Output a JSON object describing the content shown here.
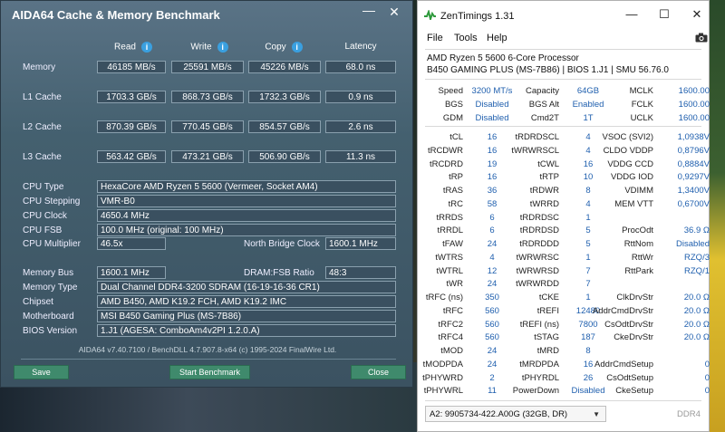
{
  "aida": {
    "title": "AIDA64 Cache & Memory Benchmark",
    "minimize_glyph": "—",
    "close_glyph": "✕",
    "columns": {
      "read": "Read",
      "write": "Write",
      "copy": "Copy",
      "latency": "Latency"
    },
    "rows": [
      {
        "label": "Memory",
        "read": "46185 MB/s",
        "write": "25591 MB/s",
        "copy": "45226 MB/s",
        "latency": "68.0 ns"
      },
      {
        "label": "L1 Cache",
        "read": "1703.3 GB/s",
        "write": "868.73 GB/s",
        "copy": "1732.3 GB/s",
        "latency": "0.9 ns"
      },
      {
        "label": "L2 Cache",
        "read": "870.39 GB/s",
        "write": "770.45 GB/s",
        "copy": "854.57 GB/s",
        "latency": "2.6 ns"
      },
      {
        "label": "L3 Cache",
        "read": "563.42 GB/s",
        "write": "473.21 GB/s",
        "copy": "506.90 GB/s",
        "latency": "11.3 ns"
      }
    ],
    "cpu": {
      "type_label": "CPU Type",
      "type": "HexaCore AMD Ryzen 5 5600  (Vermeer, Socket AM4)",
      "stepping_label": "CPU Stepping",
      "stepping": "VMR-B0",
      "clock_label": "CPU Clock",
      "clock": "4650.4 MHz",
      "fsb_label": "CPU FSB",
      "fsb": "100.0 MHz  (original: 100 MHz)",
      "mult_label": "CPU Multiplier",
      "mult": "46.5x",
      "nb_label": "North Bridge Clock",
      "nb": "1600.1 MHz"
    },
    "mem": {
      "bus_label": "Memory Bus",
      "bus": "1600.1 MHz",
      "ratio_label": "DRAM:FSB Ratio",
      "ratio": "48:3",
      "type_label": "Memory Type",
      "type": "Dual Channel DDR4-3200 SDRAM  (16-19-16-36 CR1)",
      "chipset_label": "Chipset",
      "chipset": "AMD B450, AMD K19.2 FCH, AMD K19.2 IMC",
      "mb_label": "Motherboard",
      "mb": "MSI B450 Gaming Plus (MS-7B86)",
      "bios_label": "BIOS Version",
      "bios": "1.J1  (AGESA: ComboAm4v2PI 1.2.0.A)"
    },
    "footer": "AIDA64 v7.40.7100 / BenchDLL 4.7.907.8-x64  (c) 1995-2024 FinalWire Ltd.",
    "buttons": {
      "save": "Save",
      "start": "Start Benchmark",
      "close": "Close"
    }
  },
  "zen": {
    "title": "ZenTimings 1.31",
    "win": {
      "min": "—",
      "max": "☐",
      "close": "✕"
    },
    "menu": {
      "file": "File",
      "tools": "Tools",
      "help": "Help"
    },
    "cpu_name": "AMD Ryzen 5 5600 6-Core Processor",
    "board": "B450 GAMING PLUS (MS-7B86) | BIOS 1.J1 | SMU 56.76.0",
    "top": [
      [
        {
          "l": "Speed",
          "v": "3200 MT/s"
        },
        {
          "l": "Capacity",
          "v": "64GB"
        },
        {
          "l": "MCLK",
          "v": "1600.00"
        }
      ],
      [
        {
          "l": "BGS",
          "v": "Disabled"
        },
        {
          "l": "BGS Alt",
          "v": "Enabled"
        },
        {
          "l": "FCLK",
          "v": "1600.00"
        }
      ],
      [
        {
          "l": "GDM",
          "v": "Disabled"
        },
        {
          "l": "Cmd2T",
          "v": "1T"
        },
        {
          "l": "UCLK",
          "v": "1600.00"
        }
      ]
    ],
    "timings": [
      [
        {
          "l": "tCL",
          "v": "16"
        },
        {
          "l": "tRDRDSCL",
          "v": "4"
        },
        {
          "l": "VSOC (SVI2)",
          "v": "1,0938V"
        }
      ],
      [
        {
          "l": "tRCDWR",
          "v": "16"
        },
        {
          "l": "tWRWRSCL",
          "v": "4"
        },
        {
          "l": "CLDO VDDP",
          "v": "0,8796V"
        }
      ],
      [
        {
          "l": "tRCDRD",
          "v": "19"
        },
        {
          "l": "tCWL",
          "v": "16"
        },
        {
          "l": "VDDG CCD",
          "v": "0,8884V"
        }
      ],
      [
        {
          "l": "tRP",
          "v": "16"
        },
        {
          "l": "tRTP",
          "v": "10"
        },
        {
          "l": "VDDG IOD",
          "v": "0,9297V"
        }
      ],
      [
        {
          "l": "tRAS",
          "v": "36"
        },
        {
          "l": "tRDWR",
          "v": "8"
        },
        {
          "l": "VDIMM",
          "v": "1,3400V"
        }
      ],
      [
        {
          "l": "tRC",
          "v": "58"
        },
        {
          "l": "tWRRD",
          "v": "4"
        },
        {
          "l": "MEM VTT",
          "v": "0,6700V"
        }
      ],
      [
        {
          "l": "tRRDS",
          "v": "6"
        },
        {
          "l": "tRDRDSC",
          "v": "1"
        },
        {
          "l": "",
          "v": ""
        }
      ],
      [
        {
          "l": "tRRDL",
          "v": "6"
        },
        {
          "l": "tRDRDSD",
          "v": "5"
        },
        {
          "l": "ProcOdt",
          "v": "36.9 Ω"
        }
      ],
      [
        {
          "l": "tFAW",
          "v": "24"
        },
        {
          "l": "tRDRDDD",
          "v": "5"
        },
        {
          "l": "RttNom",
          "v": "Disabled"
        }
      ],
      [
        {
          "l": "tWTRS",
          "v": "4"
        },
        {
          "l": "tWRWRSC",
          "v": "1"
        },
        {
          "l": "RttWr",
          "v": "RZQ/3"
        }
      ],
      [
        {
          "l": "tWTRL",
          "v": "12"
        },
        {
          "l": "tWRWRSD",
          "v": "7"
        },
        {
          "l": "RttPark",
          "v": "RZQ/1"
        }
      ],
      [
        {
          "l": "tWR",
          "v": "24"
        },
        {
          "l": "tWRWRDD",
          "v": "7"
        },
        {
          "l": "",
          "v": ""
        }
      ],
      [
        {
          "l": "tRFC (ns)",
          "v": "350"
        },
        {
          "l": "tCKE",
          "v": "1"
        },
        {
          "l": "ClkDrvStr",
          "v": "20.0 Ω"
        }
      ],
      [
        {
          "l": "tRFC",
          "v": "560"
        },
        {
          "l": "tREFI",
          "v": "12480"
        },
        {
          "l": "AddrCmdDrvStr",
          "v": "20.0 Ω"
        }
      ],
      [
        {
          "l": "tRFC2",
          "v": "560"
        },
        {
          "l": "tREFI (ns)",
          "v": "7800"
        },
        {
          "l": "CsOdtDrvStr",
          "v": "20.0 Ω"
        }
      ],
      [
        {
          "l": "tRFC4",
          "v": "560"
        },
        {
          "l": "tSTAG",
          "v": "187"
        },
        {
          "l": "CkeDrvStr",
          "v": "20.0 Ω"
        }
      ],
      [
        {
          "l": "tMOD",
          "v": "24"
        },
        {
          "l": "tMRD",
          "v": "8"
        },
        {
          "l": "",
          "v": ""
        }
      ],
      [
        {
          "l": "tMODPDA",
          "v": "24"
        },
        {
          "l": "tMRDPDA",
          "v": "16"
        },
        {
          "l": "AddrCmdSetup",
          "v": "0"
        }
      ],
      [
        {
          "l": "tPHYWRD",
          "v": "2"
        },
        {
          "l": "tPHYRDL",
          "v": "26"
        },
        {
          "l": "CsOdtSetup",
          "v": "0"
        }
      ],
      [
        {
          "l": "tPHYWRL",
          "v": "11"
        },
        {
          "l": "PowerDown",
          "v": "Disabled"
        },
        {
          "l": "CkeSetup",
          "v": "0"
        }
      ]
    ],
    "module": "A2: 9905734-422.A00G (32GB, DR)",
    "ddr": "DDR4",
    "colors": {
      "value": "#1f5fae",
      "accent_button": "#3f8a6c",
      "aida_bg": "#44606f"
    }
  }
}
